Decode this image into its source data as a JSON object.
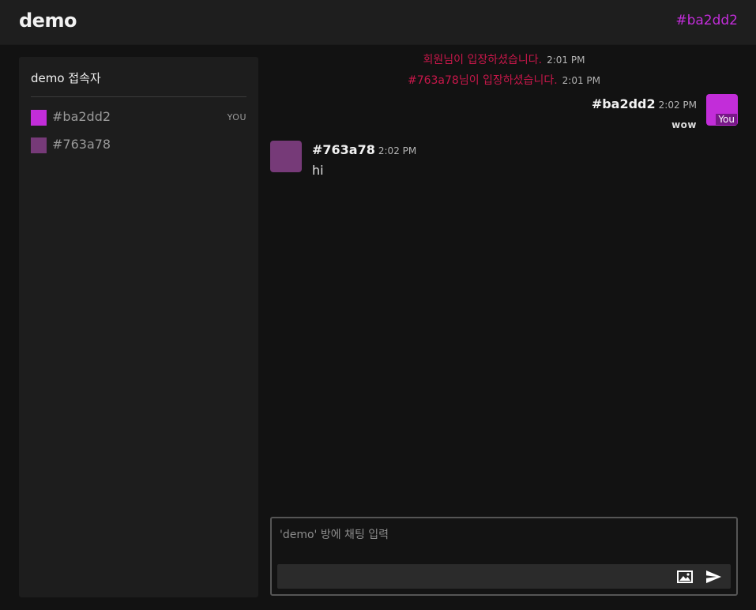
{
  "header": {
    "title": "demo",
    "my_id": "#ba2dd2"
  },
  "sidebar": {
    "title": "demo 접속자",
    "users": [
      {
        "name": "#ba2dd2",
        "color": "#c22dd9",
        "tag": "YOU"
      },
      {
        "name": "#763a78",
        "color": "#763a78",
        "tag": ""
      }
    ]
  },
  "chat": {
    "system_messages": [
      {
        "text": "회원님이 입장하셨습니다.",
        "time": "2:01 PM"
      },
      {
        "text": "#763a78님이 입장하셨습니다.",
        "time": "2:01 PM"
      }
    ],
    "messages": [
      {
        "sender": "#ba2dd2",
        "time": "2:02 PM",
        "text": "wow",
        "color": "#c22dd9",
        "avatar_tag": "You",
        "mine": true
      },
      {
        "sender": "#763a78",
        "time": "2:02 PM",
        "text": "hi",
        "color": "#763a78",
        "avatar_tag": "",
        "mine": false
      }
    ]
  },
  "composer": {
    "placeholder": "'demo' 방에 채팅 입력",
    "value": "",
    "image_icon": "image-icon",
    "send_icon": "send-icon"
  },
  "colors": {
    "system_text": "#c8174a",
    "accent": "#c22dd9"
  }
}
